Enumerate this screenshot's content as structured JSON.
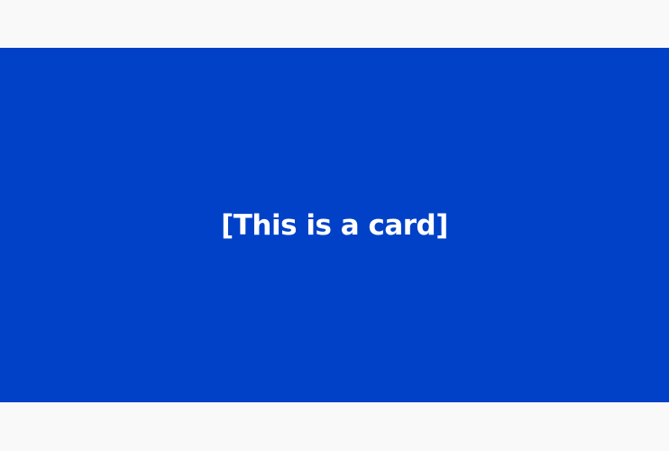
{
  "card": {
    "title": "[This is a card]",
    "background_color": "#0041c7",
    "text_color": "#ffffff"
  },
  "page": {
    "background_color": "#f9f9f9"
  }
}
